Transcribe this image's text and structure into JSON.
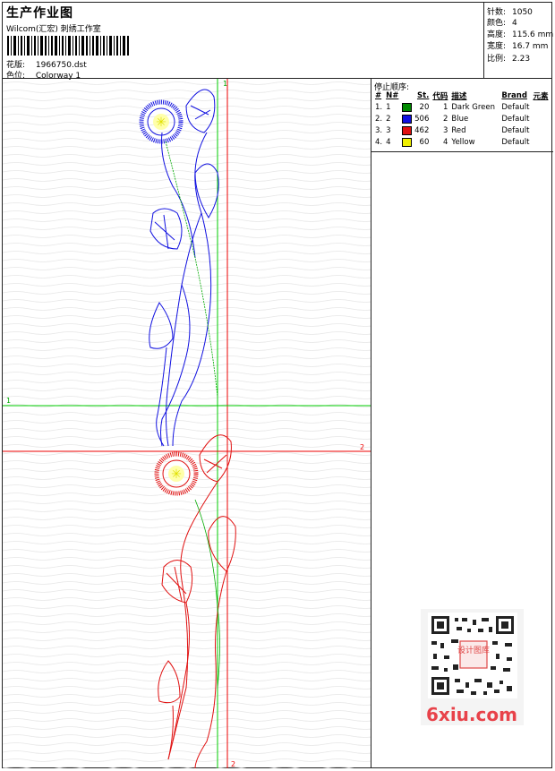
{
  "header": {
    "title": "生产作业图",
    "subtitle": "Wilcom(汇宏) 刺绣工作室",
    "design_label": "花版:",
    "design_value": "1966750.dst",
    "colorway_label": "色位:",
    "colorway_value": "Colorway 1"
  },
  "stats": [
    {
      "label": "针数:",
      "value": "1050"
    },
    {
      "label": "颜色:",
      "value": "4"
    },
    {
      "label": "高度:",
      "value": "115.6 mm"
    },
    {
      "label": "宽度:",
      "value": "16.7 mm"
    },
    {
      "label": "比例:",
      "value": "2.23"
    }
  ],
  "color_panel": {
    "heading": "停止顺序:",
    "columns": {
      "idx": "#",
      "no": "N#",
      "st": "St.",
      "code": "代码",
      "desc": "描述",
      "brand": "Brand",
      "elem": "元素"
    },
    "rows": [
      {
        "idx": "1.",
        "no": "1",
        "color": "#008a00",
        "st": "20",
        "code": "1",
        "desc": "Dark Green",
        "brand": "Default"
      },
      {
        "idx": "2.",
        "no": "2",
        "color": "#1010e0",
        "st": "506",
        "code": "2",
        "desc": "Blue",
        "brand": "Default"
      },
      {
        "idx": "3.",
        "no": "3",
        "color": "#e01010",
        "st": "462",
        "code": "3",
        "desc": "Red",
        "brand": "Default"
      },
      {
        "idx": "4.",
        "no": "4",
        "color": "#f0f000",
        "st": "60",
        "code": "4",
        "desc": "Yellow",
        "brand": "Default"
      }
    ]
  },
  "guides": {
    "v1": "1",
    "v2": "2",
    "h1": "1",
    "h2": "2",
    "v2_bottom": "2"
  },
  "watermark": {
    "text": "6xiu.com",
    "seal": "设计图库"
  },
  "colors": {
    "blue_thread": "#1010e0",
    "red_thread": "#e01010",
    "green_thread": "#008a00",
    "yellow_thread": "#f0f000",
    "guide_green": "#00cc00",
    "guide_red": "#ee0000"
  }
}
